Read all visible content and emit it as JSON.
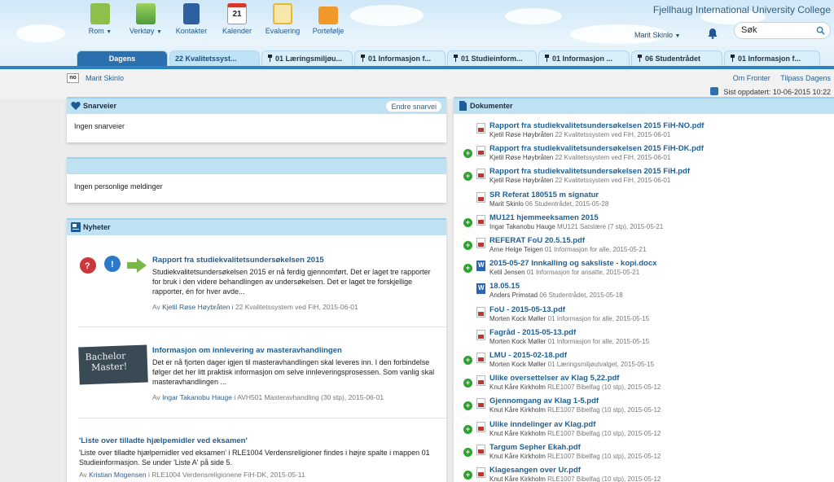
{
  "header": {
    "university": "Fjellhaug International University College",
    "apps": [
      {
        "label": "Rom",
        "dropdown": true,
        "icon": "room-icon",
        "color": "#8cc04a"
      },
      {
        "label": "Verktøy",
        "dropdown": true,
        "icon": "tools-icon",
        "color": "#6db54a"
      },
      {
        "label": "Kontakter",
        "dropdown": false,
        "icon": "contacts-icon",
        "color": "#2e5f9e"
      },
      {
        "label": "Kalender",
        "dropdown": false,
        "icon": "calendar-icon",
        "color": "#d9362b"
      },
      {
        "label": "Evaluering",
        "dropdown": false,
        "icon": "evaluation-icon",
        "color": "#e7b83a"
      },
      {
        "label": "Portefølje",
        "dropdown": false,
        "icon": "portfolio-icon",
        "color": "#f0992a"
      }
    ],
    "calendar_day": "21",
    "user_menu": "Marit Skinlo",
    "search_value": "Søk"
  },
  "tabs": [
    {
      "label": "Dagens",
      "pinned": false
    },
    {
      "label": "22 Kvalitetssyst...",
      "pinned": false
    },
    {
      "label": "01 Læringsmiljøu...",
      "pinned": true
    },
    {
      "label": "01 Informasjon f...",
      "pinned": true
    },
    {
      "label": "01 Studieinform...",
      "pinned": true
    },
    {
      "label": "01 Informasjon ...",
      "pinned": true
    },
    {
      "label": "06 Studentrådet",
      "pinned": true
    },
    {
      "label": "01 Informasjon f...",
      "pinned": true
    }
  ],
  "subheader": {
    "lang_badge": "no",
    "user": "Marit Skinlo",
    "about": "Om Fronter",
    "customize": "Tilpass Dagens",
    "updated": "Sist oppdatert: 10-06-2015 10:22"
  },
  "shortcuts": {
    "title": "Snarveier",
    "edit": "Endre snarvei",
    "empty": "Ingen snarveier"
  },
  "messages": {
    "empty": "Ingen personlige meldinger"
  },
  "news": {
    "title": "Nyheter",
    "by": "Av",
    "in": "i",
    "items": [
      {
        "title": "Rapport fra studiekvalitetsundersøkelsen 2015",
        "body": "Studiekvalitetsundersøkelsen 2015 er nå ferdig gjennomført. Det er laget tre rapporter for bruk i den videre behandlingen av undersøkelsen. Det er laget tre forskjellige rapporter, én for hver avde...",
        "author": "Kjetil Røse Høybråten",
        "source": "22 Kvalitetssystem ved FiH, 2015-06-01"
      },
      {
        "title": "Informasjon om innlevering av masteravhandlingen",
        "body": "Det er nå fjorten dager igjen til masteravhandlingen skal leveres inn. I den forbindelse følger det her litt praktisk informasjon om selve innleveringsprosessen. Som vanlig skal masteravhandlingen ...",
        "author": "Ingar Takanobu Hauge",
        "source": "AVH501 Masteravhandling (30 stp), 2015-06-01",
        "image_text": "Bachelor Master!"
      },
      {
        "title": "'Liste over tilladte hjælpemidler ved eksamen'",
        "body": "'Liste over tilladte hjælpemidler ved eksamen' i RLE1004 Verdensreligioner findes i højre spalte i mappen 01 Studieinformasjon. Se under 'Liste A' på side 5.",
        "author": "Kristian Mogensen",
        "source": "RLE1004 Verdensreligionene FiH-DK, 2015-05-11"
      }
    ]
  },
  "documents": {
    "title": "Dokumenter",
    "items": [
      {
        "title": "Rapport fra studiekvalitetsundersøkelsen 2015 FiH-NO.pdf",
        "author": "Kjetil Røse Høybråten",
        "source": "22 Kvalitetssystem ved FiH, 2015-06-01",
        "new": false,
        "type": "pdf"
      },
      {
        "title": "Rapport fra studiekvalitetsundersøkelsen 2015 FiH-DK.pdf",
        "author": "Kjetil Røse Høybråten",
        "source": "22 Kvalitetssystem ved FiH, 2015-06-01",
        "new": true,
        "type": "pdf"
      },
      {
        "title": "Rapport fra studiekvalitetsundersøkelsen 2015 FiH.pdf",
        "author": "Kjetil Røse Høybråten",
        "source": "22 Kvalitetssystem ved FiH, 2015-06-01",
        "new": true,
        "type": "pdf"
      },
      {
        "title": "SR Referat 180515 m signatur",
        "author": "Marit Skinlo",
        "source": "06 Studentrådet, 2015-05-28",
        "new": false,
        "type": "pdf"
      },
      {
        "title": "MU121 hjemmeeksamen 2015",
        "author": "Ingar Takanobu Hauge",
        "source": "MU121 Satslære (7 stp), 2015-05-21",
        "new": true,
        "type": "pdf"
      },
      {
        "title": "REFERAT FoU 20.5.15.pdf",
        "author": "Arne Helge Teigen",
        "source": "01 Informasjon for alle, 2015-05-21",
        "new": true,
        "type": "pdf"
      },
      {
        "title": "2015-05-27 Innkalling og saksliste - kopi.docx",
        "author": "Ketil Jensen",
        "source": "01 Informasjon for ansatte, 2015-05-21",
        "new": true,
        "type": "doc"
      },
      {
        "title": "18.05.15",
        "author": "Anders Primstad",
        "source": "06 Studentrådet, 2015-05-18",
        "new": false,
        "type": "doc"
      },
      {
        "title": "FoU - 2015-05-13.pdf",
        "author": "Morten Kock Møller",
        "source": "01 Informasjon for alle, 2015-05-15",
        "new": false,
        "type": "pdf"
      },
      {
        "title": "Fagråd - 2015-05-13.pdf",
        "author": "Morten Kock Møller",
        "source": "01 Informasjon for alle, 2015-05-15",
        "new": false,
        "type": "pdf"
      },
      {
        "title": "LMU - 2015-02-18.pdf",
        "author": "Morten Kock Møller",
        "source": "01 Læringsmiljøutvalget, 2015-05-15",
        "new": true,
        "type": "pdf"
      },
      {
        "title": "Ulike oversettelser av Klag 5,22.pdf",
        "author": "Knut Kåre Kirkholm",
        "source": "RLE1007 Bibelfag (10 stp), 2015-05-12",
        "new": true,
        "type": "pdf"
      },
      {
        "title": "Gjennomgang av Klag 1-5.pdf",
        "author": "Knut Kåre Kirkholm",
        "source": "RLE1007 Bibelfag (10 stp), 2015-05-12",
        "new": true,
        "type": "pdf"
      },
      {
        "title": "Ulike inndelinger av Klag.pdf",
        "author": "Knut Kåre Kirkholm",
        "source": "RLE1007 Bibelfag (10 stp), 2015-05-12",
        "new": true,
        "type": "pdf"
      },
      {
        "title": "Targum Sepher Ekah.pdf",
        "author": "Knut Kåre Kirkholm",
        "source": "RLE1007 Bibelfag (10 stp), 2015-05-12",
        "new": true,
        "type": "pdf"
      },
      {
        "title": "Klagesangen over Ur.pdf",
        "author": "Knut Kåre Kirkholm",
        "source": "RLE1007 Bibelfag (10 stp), 2015-05-12",
        "new": true,
        "type": "pdf"
      }
    ]
  }
}
